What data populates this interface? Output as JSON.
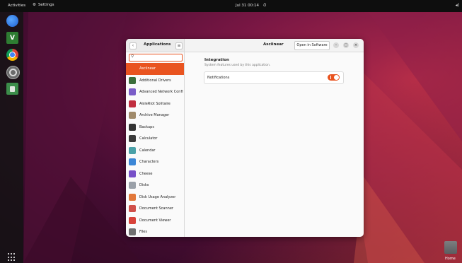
{
  "topbar": {
    "activities": "Activities",
    "settings_label": "Settings",
    "clock": "Jul 31  00:14",
    "alarm_icon": "alarm-icon",
    "system_icon": "speaker-icon"
  },
  "dock": {
    "apps": [
      "thunderbird",
      "vim",
      "chromium",
      "settings",
      "trash"
    ],
    "show_apps_icon": "grid-icon"
  },
  "desktop": {
    "home_label": "Home"
  },
  "window": {
    "left_title": "Applications",
    "right_title": "Asciinear",
    "open_in_software": "Open in Software",
    "search_placeholder": "",
    "apps": [
      {
        "label": "Asciinear",
        "color": "#e95420",
        "selected": true
      },
      {
        "label": "Additional Drivers",
        "color": "#3b6e3b"
      },
      {
        "label": "Advanced Network Confi...",
        "color": "#7a5dc8"
      },
      {
        "label": "AisleRiot Solitaire",
        "color": "#c02d3e"
      },
      {
        "label": "Archive Manager",
        "color": "#a08a6a"
      },
      {
        "label": "Backups",
        "color": "#333333"
      },
      {
        "label": "Calculator",
        "color": "#3a3a3a"
      },
      {
        "label": "Calendar",
        "color": "#4aa1a8"
      },
      {
        "label": "Characters",
        "color": "#3b86d6"
      },
      {
        "label": "Cheese",
        "color": "#7750c8"
      },
      {
        "label": "Disks",
        "color": "#9aa0a8"
      },
      {
        "label": "Disk Usage Analyzer",
        "color": "#e2783a"
      },
      {
        "label": "Document Scanner",
        "color": "#d0504a"
      },
      {
        "label": "Document Viewer",
        "color": "#d8433a"
      },
      {
        "label": "Files",
        "color": "#6f6f6f"
      }
    ],
    "section_title": "Integration",
    "section_subtitle": "System features used by this application.",
    "notifications_label": "Notifications",
    "notifications_on": true,
    "accent": "#e95420"
  }
}
